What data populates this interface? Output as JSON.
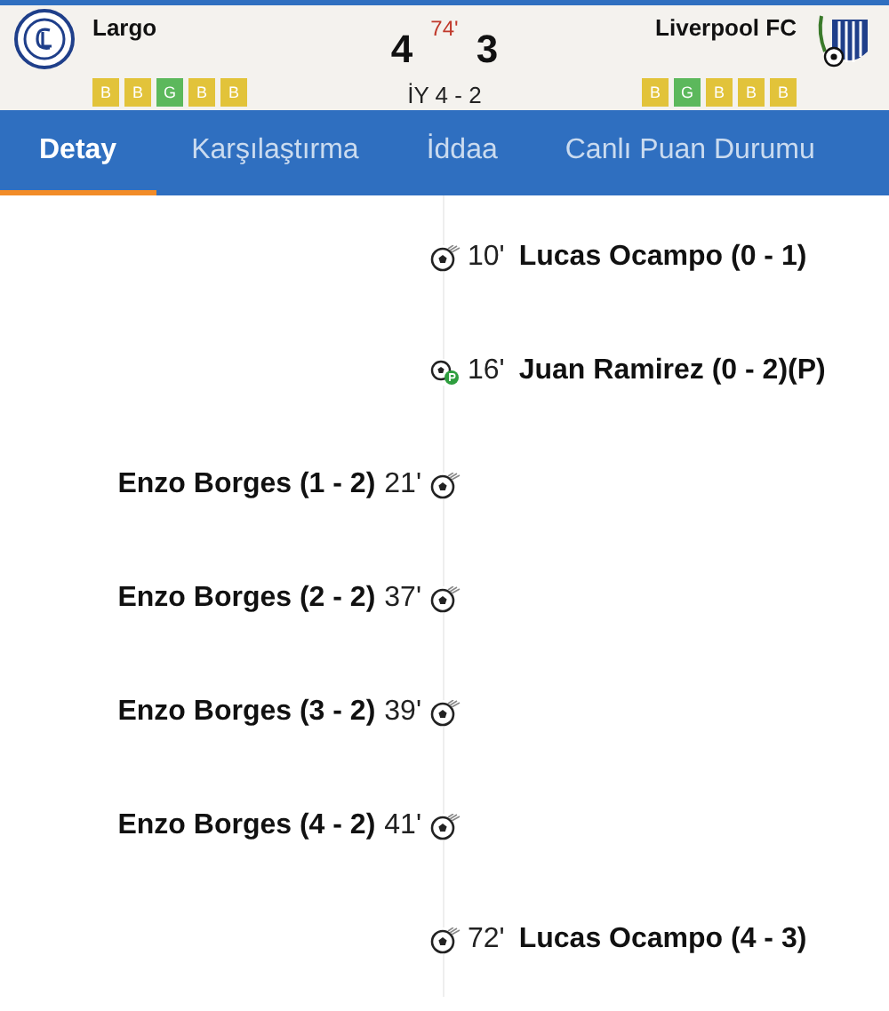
{
  "match": {
    "home": {
      "name": "Largo",
      "form": [
        {
          "letter": "B",
          "color": "#e2c33a"
        },
        {
          "letter": "B",
          "color": "#e2c33a"
        },
        {
          "letter": "G",
          "color": "#5cb85c"
        },
        {
          "letter": "B",
          "color": "#e2c33a"
        },
        {
          "letter": "B",
          "color": "#e2c33a"
        }
      ]
    },
    "away": {
      "name": "Liverpool FC",
      "form": [
        {
          "letter": "B",
          "color": "#e2c33a"
        },
        {
          "letter": "G",
          "color": "#5cb85c"
        },
        {
          "letter": "B",
          "color": "#e2c33a"
        },
        {
          "letter": "B",
          "color": "#e2c33a"
        },
        {
          "letter": "B",
          "color": "#e2c33a"
        }
      ]
    },
    "home_score": "4",
    "away_score": "3",
    "minute": "74'",
    "half_time": "İY 4 - 2"
  },
  "tabs": [
    {
      "label": "Detay",
      "selected": true
    },
    {
      "label": "Karşılaştırma",
      "selected": false
    },
    {
      "label": "İddaa",
      "selected": false
    },
    {
      "label": "Canlı Puan Durumu",
      "selected": false
    }
  ],
  "events": [
    {
      "home_team": false,
      "kind": "goal",
      "minute": "10'",
      "text": "Lucas Ocampo (0 - 1)"
    },
    {
      "home_team": false,
      "kind": "penalty",
      "minute": "16'",
      "text": "Juan Ramirez (0 - 2)(P)"
    },
    {
      "home_team": true,
      "kind": "goal",
      "minute": "21'",
      "text": "Enzo Borges (1 - 2)"
    },
    {
      "home_team": true,
      "kind": "goal",
      "minute": "37'",
      "text": "Enzo Borges (2 - 2)"
    },
    {
      "home_team": true,
      "kind": "goal",
      "minute": "39'",
      "text": "Enzo Borges (3 - 2)"
    },
    {
      "home_team": true,
      "kind": "goal",
      "minute": "41'",
      "text": "Enzo Borges (4 - 2)"
    },
    {
      "home_team": false,
      "kind": "goal",
      "minute": "72'",
      "text": "Lucas Ocampo (4 - 3)"
    }
  ]
}
